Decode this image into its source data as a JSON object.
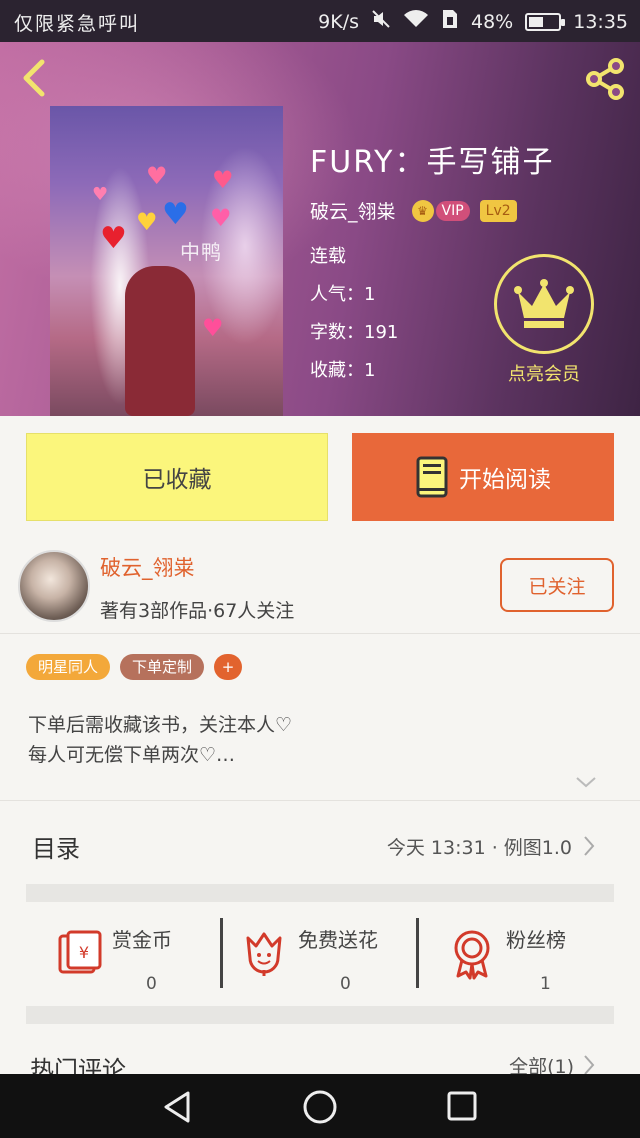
{
  "status_bar": {
    "left_text": "仅限紧急呼叫",
    "net_speed": "9K/s",
    "battery": "48%",
    "battery_level": 0.48,
    "time": "13:35"
  },
  "book": {
    "title": "FURY：手写铺子",
    "author": "破云_翎粜",
    "vip_label": "VIP",
    "level": "Lv2",
    "status": "连载",
    "popularity": "人气：1",
    "word_count": "字数：191",
    "favorites": "收藏：1",
    "cover_watermark": "中鸭",
    "member_label": "点亮会员"
  },
  "actions": {
    "collected_label": "已收藏",
    "read_label": "开始阅读"
  },
  "author_card": {
    "name": "破云_翎粜",
    "stats": "著有3部作品·67人关注",
    "follow_label": "已关注"
  },
  "tags": [
    {
      "label": "明星同人",
      "color": "#f3a83a"
    },
    {
      "label": "下单定制",
      "color": "#b6715c"
    },
    {
      "label": "+",
      "color": "#e2632e"
    }
  ],
  "description": {
    "line1": "下单后需收藏该书，关注本人♡",
    "line2": "每人可无偿下单两次♡…"
  },
  "catalog": {
    "label": "目录",
    "update_text": "今天 13:31 · 例图1.0"
  },
  "stats": [
    {
      "label": "赏金币",
      "value": "0",
      "icon": "reward-coin-icon"
    },
    {
      "label": "免费送花",
      "value": "0",
      "icon": "flower-icon"
    },
    {
      "label": "粉丝榜",
      "value": "1",
      "icon": "rank-ribbon-icon"
    }
  ],
  "hot_comments": {
    "label": "热门评论",
    "all_label": "全部(1)"
  },
  "colors": {
    "accent": "#e8683a",
    "collected_bg": "#fbf67c",
    "member_gold": "#f2e46e"
  }
}
